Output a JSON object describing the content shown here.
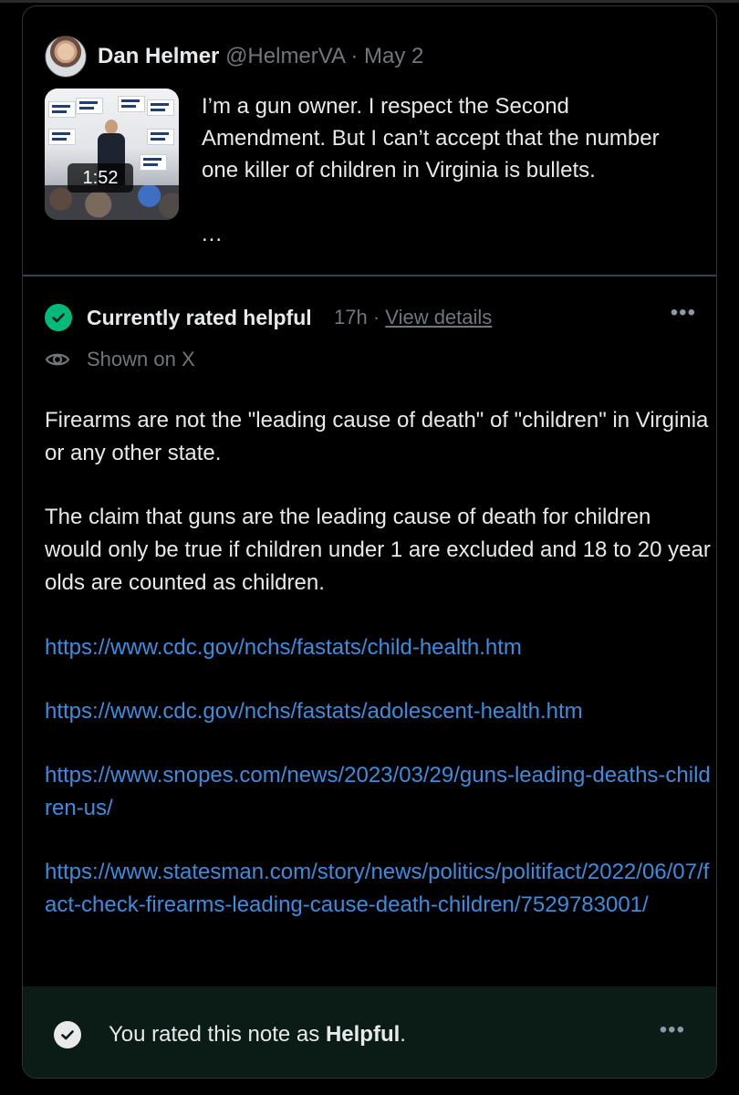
{
  "tweet": {
    "author_name": "Dan Helmer",
    "handle": "@HelmerVA",
    "separator": "·",
    "date": "May 2",
    "video_duration": "1:52",
    "text": "I’m a gun owner. I respect the Second Amendment. But I can’t accept that the number one killer of children in Virginia is bullets.",
    "truncation": "..."
  },
  "note": {
    "status_label": "Currently rated helpful",
    "age": "17h",
    "separator": "·",
    "view_details_label": "View details",
    "more_label": "•••",
    "shown_label": "Shown on X",
    "paragraph_1": "Firearms are not the \"leading cause of death\" of \"children\" in Virginia or any other state.",
    "paragraph_2": "The claim that guns are the leading cause of death for children would only be true if children under 1 are excluded and 18 to 20 year olds are counted as children.",
    "links": [
      "https://www.cdc.gov/nchs/fastats/child-health.htm",
      "https://www.cdc.gov/nchs/fastats/adolescent-health.htm",
      "https://www.snopes.com/news/2023/03/29/guns-leading-deaths-children-us/",
      "https://www.statesman.com/story/news/politics/politifact/2022/06/07/fact-check-firearms-leading-cause-death-children/7529783001/"
    ]
  },
  "footer": {
    "rated_prefix": "You rated this note as ",
    "rating": "Helpful",
    "rated_suffix": ".",
    "more_label": "•••"
  },
  "colors": {
    "helpful_green": "#00ba7c",
    "link_blue": "#3b8de0",
    "footer_bg": "#0b1b15"
  }
}
